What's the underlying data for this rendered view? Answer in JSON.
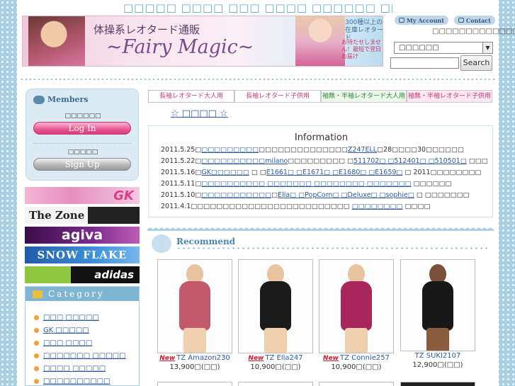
{
  "site_title": "□□□□□ □□□□ □□□ □□□□ □□□□□□ □□□□□□ □□□□ □□□□□□□□",
  "banner": {
    "subline": "体操系レオタード通販",
    "logo": "~Fairy Magic~",
    "stock": "300種以上の在庫レオタード",
    "shipping": "お待たせしません！最短で翌日お届け"
  },
  "header": {
    "my_account": "My Account",
    "contact": "Contact",
    "tagline": "□□□□□□□□□□□□□□·",
    "select_value": "□□□□□□",
    "search_label": "Search"
  },
  "members": {
    "title": "Members",
    "login_caption": "□□□□□□",
    "login_label": "Log In",
    "signup_caption": "□□□□□",
    "signup_label": "Sign Up"
  },
  "brands": [
    "GK",
    "The Zone",
    "agiva",
    "SNOW FLAKE",
    "adidas"
  ],
  "category": {
    "title": "Category",
    "items": [
      "□□□ □□□□□",
      "GK □□□□□",
      "□□□ □□□□",
      "□□□□□□□ □□□□□",
      "□□□□ □□□□□",
      "□□□□□□□□□□"
    ]
  },
  "tabs": [
    "長袖レオタード大人用",
    "長袖レオタード子供用",
    "袖無・半袖レオタード大人用",
    "袖無・半袖レオタード子供用"
  ],
  "stars_link": "☆ □□□□ ☆",
  "information": {
    "title": "Information",
    "news": [
      {
        "date": "2011.5.25",
        "pre": "□",
        "l1": "□□□□□□□□□",
        "mid": "□□□□□□□□□□□□□□",
        "l2": "Z247ELL",
        "post": "□28□□□□30□□□□□□"
      },
      {
        "date": "2011.5.22",
        "pre": "□",
        "l1": "□□□□□□□□□□milano",
        "mid": "□□□□□□□□□ □",
        "l2": "511702□ □512401□ □510501□",
        "post": " □□□"
      },
      {
        "date": "2011.5.16",
        "pre": "□",
        "l1": "GK□□□□□□",
        "mid": " □ □",
        "l2": "E1661□ □E1671□ □E1680□ □E1659□",
        "post": " □ 2011□□□□□□□□"
      },
      {
        "date": "2011.5.11",
        "pre": "□",
        "l1": "□□□□□□□□□□ □□□□□□□ □□□□□□□□ □□□□□□□",
        "mid": "",
        "l2": "",
        "post": " □□□□□□"
      },
      {
        "date": "2011.5.10",
        "pre": "□",
        "l1": "□□□□□□□□□□□",
        "mid": "□",
        "l2": "Ella□ □PopCorn□ □Deluxe□ □sophie□",
        "post": " □ □□□□□□□"
      },
      {
        "date": "2011.4.1",
        "pre": "□□□□□□□□□□□□□□□□□□□□□□□□□ ",
        "l1": "□□□□□□□□",
        "mid": "",
        "l2": "",
        "post": " □□□□"
      }
    ]
  },
  "recommend": {
    "title": "Recommend",
    "new_badge": "New",
    "products": [
      {
        "name": "TZ Amazon230",
        "price": "13,900□(□□)",
        "is_new": true,
        "color": "#c25a6b"
      },
      {
        "name": "TZ Ella247",
        "price": "10,900□(□□)",
        "is_new": true,
        "color": "#1b1b1b"
      },
      {
        "name": "TZ Connie257",
        "price": "10,900□(□□)",
        "is_new": true,
        "color": "#a8265b"
      },
      {
        "name": "TZ SUKI2107",
        "price": "12,900□(□□)",
        "is_new": false,
        "color": "#181818"
      }
    ]
  }
}
